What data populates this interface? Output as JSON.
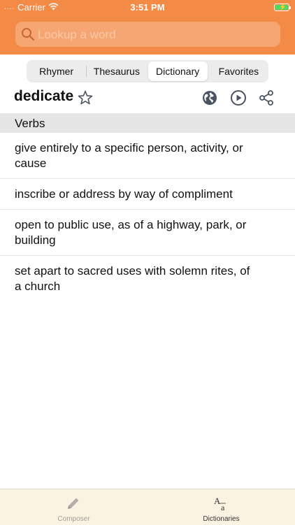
{
  "status_bar": {
    "signal_dots": "....",
    "carrier": "Carrier",
    "time": "3:51 PM"
  },
  "search": {
    "placeholder": "Lookup a word",
    "value": ""
  },
  "segments": [
    {
      "label": "Rhymer",
      "active": false
    },
    {
      "label": "Thesaurus",
      "active": false
    },
    {
      "label": "Dictionary",
      "active": true
    },
    {
      "label": "Favorites",
      "active": false
    }
  ],
  "entry": {
    "word": "dedicate",
    "section": "Verbs",
    "definitions": [
      "give entirely to a specific person, activity, or cause",
      "inscribe or address by way of compliment",
      "open to public use, as of a highway, park, or building",
      "set apart to sacred uses with solemn rites, of a church"
    ]
  },
  "icons": {
    "favorite": "star-icon",
    "web": "globe-icon",
    "audio": "play-icon",
    "share": "share-icon"
  },
  "tabbar": {
    "tabs": [
      {
        "label": "Composer",
        "icon": "pencil-icon",
        "active": false
      },
      {
        "label": "Dictionaries",
        "icon": "dictionary-icon",
        "active": true
      }
    ]
  },
  "colors": {
    "accent": "#f38a45",
    "search_bg": "#f6a673",
    "icon_gray": "#4a5460",
    "tabbar_bg": "#fbf3e2"
  }
}
